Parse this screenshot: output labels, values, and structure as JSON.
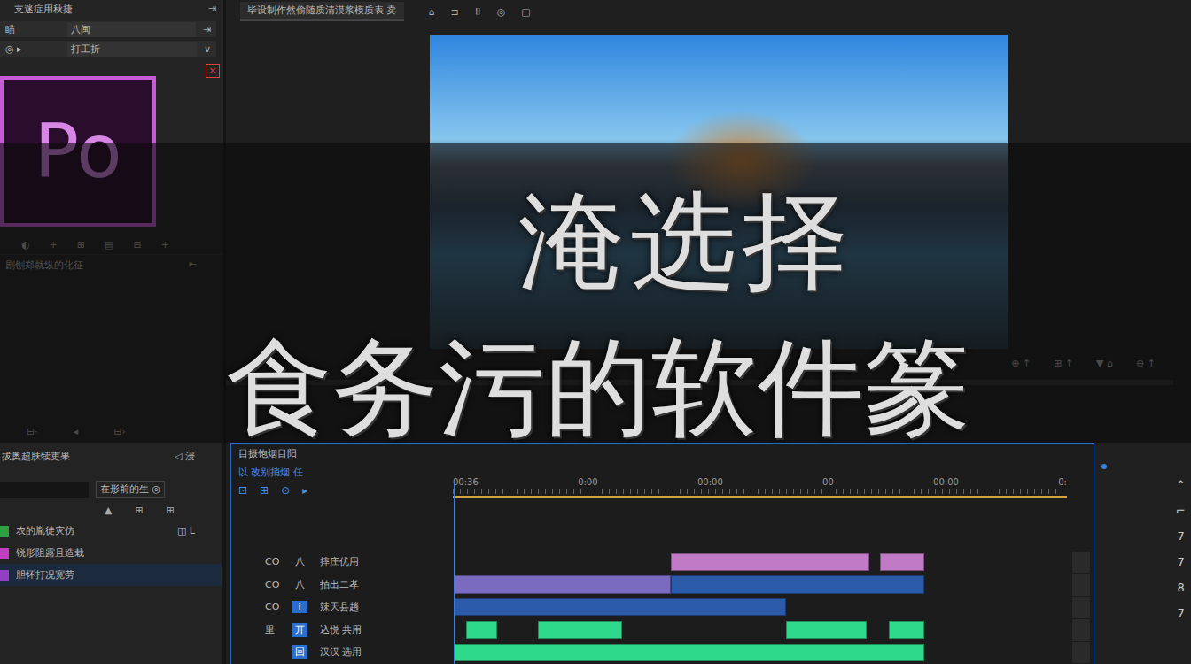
{
  "app_logo": "Po",
  "headline": {
    "line1": "淹选择",
    "line2": "食务污的软件篆"
  },
  "project_panel": {
    "title": "支迷症用秋捷",
    "title_icon": "⇥",
    "rows": [
      {
        "label": "瞄",
        "value": "八闽",
        "icon": "⇥"
      },
      {
        "label": "◎ ▸",
        "value": "打工折",
        "icon": "∨"
      }
    ],
    "close_icon": "×",
    "tool_icons": [
      "◐",
      "+",
      "⊞",
      "▤",
      "⊟",
      "+"
    ],
    "media_item": "剧刨郑就纵的化征",
    "media_icon": "⇤",
    "footer_icons": [
      "⊟·",
      "◂",
      "⊟›"
    ]
  },
  "monitor": {
    "title": "毕设制作然偷随质清漠浆模质表 卖",
    "toolbar_icons": [
      "⌂",
      "⊐",
      "⌷",
      "◎",
      "▢"
    ],
    "controls": [
      "⊕ ↑",
      "⊞ ↑",
      "▼ ⌂",
      "⊖ ↑"
    ]
  },
  "effects_panel": {
    "title": "拔奥超肤犊吏果",
    "title_icon": "◁ 浸",
    "search": "在形前的生 ◎",
    "icons": [
      "▲",
      "⊞",
      "⊞"
    ],
    "items": [
      {
        "label": "农的胤徒灾仿",
        "color": "#2ea043",
        "selected": false,
        "right": "◫ L"
      },
      {
        "label": "锐形阻露且造栽",
        "color": "#c040c0",
        "selected": false,
        "right": ""
      },
      {
        "label": "胆怀打况宽劳",
        "color": "#9040c0",
        "selected": true,
        "right": ""
      }
    ]
  },
  "timeline": {
    "title": "目摄饱烟目阳",
    "sequence": "以 改别捎烟 任",
    "tool_icons": [
      "⊡",
      "⊞",
      "⊙",
      "▸"
    ],
    "ruler": [
      "00:36",
      "0:00",
      "00:00",
      "00",
      "00:00",
      "0:"
    ],
    "tracks": [
      {
        "lock": "CO",
        "target": "八",
        "name": "摔庄优用",
        "selected": false,
        "clips": [
          {
            "start": 0.355,
            "end": 0.678,
            "color": "#c07ac6"
          },
          {
            "start": 0.696,
            "end": 0.768,
            "color": "#c07ac6"
          }
        ]
      },
      {
        "lock": "CO",
        "target": "八",
        "name": "拍出二孝",
        "selected": false,
        "clips": [
          {
            "start": 0.003,
            "end": 0.355,
            "color": "#7a6ac0"
          },
          {
            "start": 0.355,
            "end": 0.768,
            "color": "#2a5aa8"
          }
        ]
      },
      {
        "lock": "CO",
        "target": "i",
        "name": "辣天县趟",
        "selected": true,
        "clips": [
          {
            "start": 0.003,
            "end": 0.543,
            "color": "#2a5aa8"
          }
        ]
      },
      {
        "lock": "里",
        "target": "丌",
        "name": "込悦 共用",
        "selected": true,
        "clips": [
          {
            "start": 0.022,
            "end": 0.072,
            "color": "#2fd98c"
          },
          {
            "start": 0.138,
            "end": 0.275,
            "color": "#2fd98c"
          },
          {
            "start": 0.543,
            "end": 0.674,
            "color": "#2fd98c"
          },
          {
            "start": 0.71,
            "end": 0.768,
            "color": "#2fd98c"
          }
        ]
      },
      {
        "lock": "",
        "target": "回",
        "name": "汉汉 选用",
        "selected": true,
        "clips": [
          {
            "start": 0.003,
            "end": 0.768,
            "color": "#2fd98c"
          }
        ]
      }
    ]
  },
  "right_tools": [
    "⌃",
    "⌐",
    "7",
    "7",
    "8",
    "7"
  ]
}
